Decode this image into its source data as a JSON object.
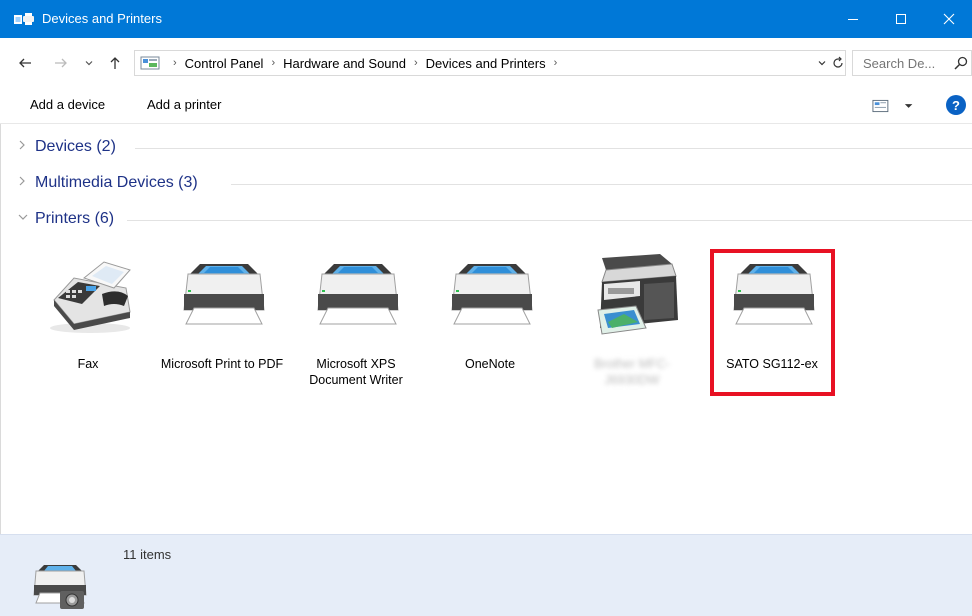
{
  "window": {
    "title": "Devices and Printers"
  },
  "address_bar": {
    "breadcrumbs": [
      "Control Panel",
      "Hardware and Sound",
      "Devices and Printers"
    ],
    "search_placeholder": "Search De..."
  },
  "command_bar": {
    "add_device": "Add a device",
    "add_printer": "Add a printer",
    "help": "?"
  },
  "groups": {
    "devices": "Devices (2)",
    "multimedia": "Multimedia Devices (3)",
    "printers": "Printers (6)"
  },
  "printers": [
    {
      "name": "Fax",
      "icon": "fax-icon"
    },
    {
      "name": "Microsoft Print to PDF",
      "icon": "printer-icon"
    },
    {
      "name": "Microsoft XPS Document Writer",
      "icon": "printer-icon"
    },
    {
      "name": "OneNote",
      "icon": "printer-icon"
    },
    {
      "name": "Brother MFC-J6930DW",
      "icon": "mfp-printer-icon",
      "blurred": true
    },
    {
      "name": "SATO SG112-ex",
      "icon": "printer-icon",
      "highlighted": true
    }
  ],
  "status": {
    "item_count": "11 items"
  },
  "colors": {
    "titlebar": "#0078d7",
    "group_title": "#1e3287",
    "highlight": "#e81123",
    "details_pane": "#e6edf8"
  }
}
